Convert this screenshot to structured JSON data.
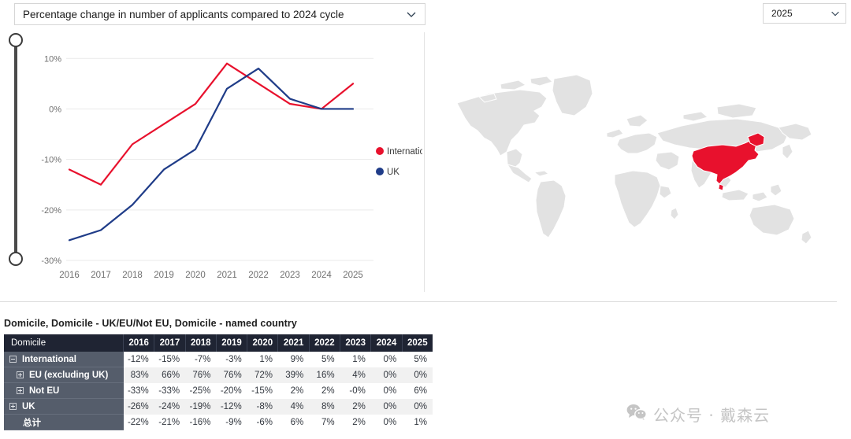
{
  "metric_select": {
    "value": "Percentage change in number of applicants compared to 2024 cycle",
    "chevron": "chevron-down-icon"
  },
  "year_select": {
    "value": "2025",
    "chevron": "chevron-down-icon"
  },
  "range_slider": {
    "orientation": "vertical",
    "top_handle": "range-handle-top",
    "bottom_handle": "range-handle-bottom"
  },
  "chart_data": {
    "type": "line",
    "title": "",
    "xlabel": "",
    "ylabel": "",
    "categories": [
      "2016",
      "2017",
      "2018",
      "2019",
      "2020",
      "2021",
      "2022",
      "2023",
      "2024",
      "2025"
    ],
    "ytick_labels": [
      "10%",
      "0%",
      "-10%",
      "-20%",
      "-30%"
    ],
    "ytick_values": [
      10,
      0,
      -10,
      -20,
      -30
    ],
    "ylim": [
      -30,
      13
    ],
    "grid": true,
    "legend_position": "right",
    "series": [
      {
        "name": "International",
        "color": "#E8112D",
        "values": [
          -12,
          -15,
          -7,
          -3,
          1,
          9,
          5,
          1,
          0,
          5
        ]
      },
      {
        "name": "UK",
        "color": "#1F3C88",
        "values": [
          -26,
          -24,
          -19,
          -12,
          -8,
          4,
          8,
          2,
          0,
          0
        ]
      }
    ]
  },
  "map": {
    "name": "world-map",
    "highlighted_country": "China",
    "highlight_color": "#E8112D",
    "base_color": "#E2E2E2"
  },
  "table": {
    "title": "Domicile, Domicile - UK/EU/Not EU, Domicile - named country",
    "dimension_header": "Domicile",
    "year_headers": [
      "2016",
      "2017",
      "2018",
      "2019",
      "2020",
      "2021",
      "2022",
      "2023",
      "2024",
      "2025"
    ],
    "rows": [
      {
        "label": "International",
        "level": 0,
        "toggle": "minus",
        "values": [
          "-12%",
          "-15%",
          "-7%",
          "-3%",
          "1%",
          "9%",
          "5%",
          "1%",
          "0%",
          "5%"
        ]
      },
      {
        "label": "EU (excluding UK)",
        "level": 1,
        "toggle": "plus",
        "values": [
          "83%",
          "66%",
          "76%",
          "76%",
          "72%",
          "39%",
          "16%",
          "4%",
          "0%",
          "0%"
        ]
      },
      {
        "label": "Not EU",
        "level": 1,
        "toggle": "plus",
        "values": [
          "-33%",
          "-33%",
          "-25%",
          "-20%",
          "-15%",
          "2%",
          "2%",
          "-0%",
          "0%",
          "6%"
        ]
      },
      {
        "label": "UK",
        "level": 0,
        "toggle": "plus",
        "values": [
          "-26%",
          "-24%",
          "-19%",
          "-12%",
          "-8%",
          "4%",
          "8%",
          "2%",
          "0%",
          "0%"
        ]
      },
      {
        "label": "总计",
        "level": 0,
        "toggle": "none",
        "values": [
          "-22%",
          "-21%",
          "-16%",
          "-9%",
          "-6%",
          "6%",
          "7%",
          "2%",
          "0%",
          "1%"
        ]
      }
    ]
  },
  "watermark": {
    "icon": "wechat-icon",
    "text": "公众号 · 戴森云"
  }
}
